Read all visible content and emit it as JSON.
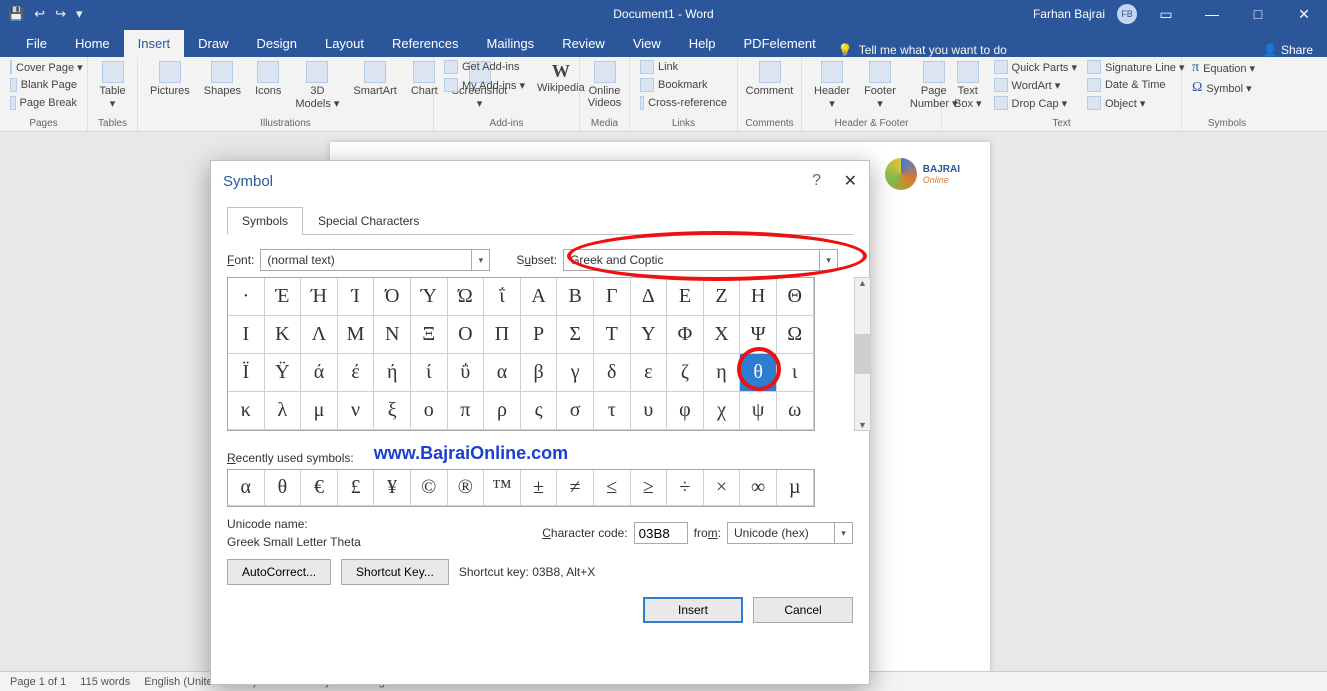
{
  "title": "Document1 - Word",
  "user": {
    "name": "Farhan Bajrai",
    "initials": "FB"
  },
  "qat": [
    "💾",
    "↩",
    "↪",
    "▾"
  ],
  "win": {
    "min": "—",
    "max": "□",
    "close": "✕",
    "rib": "▭"
  },
  "tabs": [
    "File",
    "Home",
    "Insert",
    "Draw",
    "Design",
    "Layout",
    "References",
    "Mailings",
    "Review",
    "View",
    "Help",
    "PDFelement"
  ],
  "tab_active": "Insert",
  "tell_me": "Tell me what you want to do",
  "share": "Share",
  "ribbon": {
    "pages": {
      "label": "Pages",
      "items": [
        "Cover Page ▾",
        "Blank Page",
        "Page Break"
      ]
    },
    "tables": {
      "label": "Tables",
      "btn": "Table"
    },
    "illus": {
      "label": "Illustrations",
      "btns": [
        "Pictures",
        "Shapes",
        "Icons",
        "3D\nModels ▾",
        "SmartArt",
        "Chart",
        "Screenshot\n▾"
      ]
    },
    "addins": {
      "label": "Add-ins",
      "items": [
        "Get Add-ins",
        "My Add-ins ▾"
      ],
      "wiki": "Wikipedia"
    },
    "media": {
      "label": "Media",
      "btn": "Online\nVideos"
    },
    "links": {
      "label": "Links",
      "items": [
        "Link",
        "Bookmark",
        "Cross-reference"
      ]
    },
    "comments": {
      "label": "Comments",
      "btn": "Comment"
    },
    "hf": {
      "label": "Header & Footer",
      "btns": [
        "Header\n▾",
        "Footer\n▾",
        "Page\nNumber ▾"
      ]
    },
    "text": {
      "label": "Text",
      "btn": "Text\nBox ▾",
      "items": [
        "Quick Parts ▾",
        "WordArt ▾",
        "Drop Cap ▾"
      ],
      "items2": [
        "Signature Line ▾",
        "Date & Time",
        "Object ▾"
      ]
    },
    "symbols": {
      "label": "Symbols",
      "items": [
        "Equation ▾",
        "Symbol ▾"
      ]
    }
  },
  "bajrai": {
    "name": "BAJRAI",
    "sub": "Online"
  },
  "dlg": {
    "title": "Symbol",
    "tabs": [
      "Symbols",
      "Special Characters"
    ],
    "font_label": "Font:",
    "font_value": "(normal text)",
    "subset_label": "Subset:",
    "subset_value": "Greek and Coptic",
    "rows": [
      [
        "·",
        "Έ",
        "Ή",
        "Ί",
        "Ό",
        "Ύ",
        "Ώ",
        "ΐ",
        "Α",
        "Β",
        "Γ",
        "Δ",
        "Ε",
        "Ζ",
        "Η",
        "Θ"
      ],
      [
        "Ι",
        "Κ",
        "Λ",
        "Μ",
        "Ν",
        "Ξ",
        "Ο",
        "Π",
        "Ρ",
        "Σ",
        "Τ",
        "Υ",
        "Φ",
        "Χ",
        "Ψ",
        "Ω"
      ],
      [
        "Ϊ",
        "Ϋ",
        "ά",
        "έ",
        "ή",
        "ί",
        "ΰ",
        "α",
        "β",
        "γ",
        "δ",
        "ε",
        "ζ",
        "η",
        "θ",
        "ι"
      ],
      [
        "κ",
        "λ",
        "μ",
        "ν",
        "ξ",
        "ο",
        "π",
        "ρ",
        "ς",
        "σ",
        "τ",
        "υ",
        "φ",
        "χ",
        "ψ",
        "ω"
      ]
    ],
    "selected": "θ",
    "recent_label": "Recently used symbols:",
    "link": "www.BajraiOnline.com",
    "recent": [
      "α",
      "θ",
      "€",
      "£",
      "¥",
      "©",
      "®",
      "™",
      "±",
      "≠",
      "≤",
      "≥",
      "÷",
      "×",
      "∞",
      "µ"
    ],
    "uname_label": "Unicode name:",
    "uname_value": "Greek Small Letter Theta",
    "code_label": "Character code:",
    "code_value": "03B8",
    "from_label": "from:",
    "from_value": "Unicode (hex)",
    "autocorrect": "AutoCorrect...",
    "shortcut_btn": "Shortcut Key...",
    "shortcut_txt": "Shortcut key: 03B8, Alt+X",
    "insert": "Insert",
    "cancel": "Cancel"
  },
  "status": {
    "page": "Page 1 of 1",
    "words": "115 words",
    "lang": "English (United States)",
    "acc": "Accessibility: Good to go"
  }
}
